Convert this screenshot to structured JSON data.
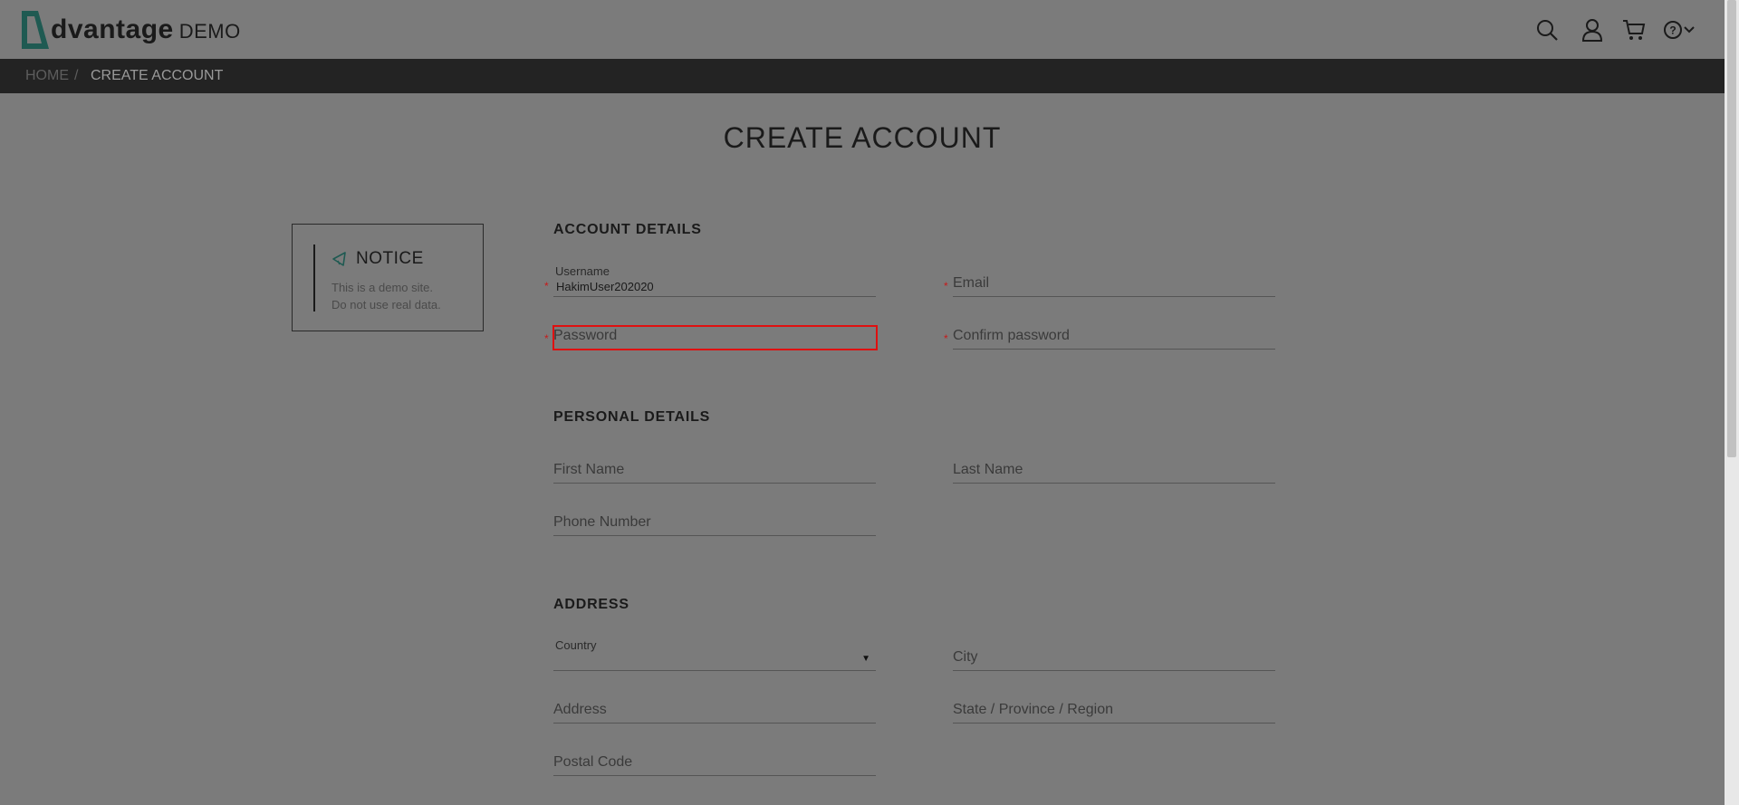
{
  "header": {
    "logo_text": "dvantage",
    "logo_demo": "DEMO",
    "icons": [
      "search-icon",
      "user-icon",
      "cart-icon",
      "help-icon",
      "chevron-down-icon"
    ]
  },
  "breadcrumb": {
    "home": "HOME",
    "separator": "/",
    "current": "CREATE ACCOUNT"
  },
  "page_title": "CREATE ACCOUNT",
  "notice": {
    "title": "NOTICE",
    "line1": "This is a demo site.",
    "line2": "Do not use real data."
  },
  "account_details": {
    "title": "ACCOUNT DETAILS",
    "username_label": "Username",
    "username_value": "HakimUser202020",
    "email_label": "Email",
    "password_label": "Password",
    "confirm_password_label": "Confirm password"
  },
  "personal_details": {
    "title": "PERSONAL DETAILS",
    "first_name_label": "First Name",
    "last_name_label": "Last Name",
    "phone_label": "Phone Number"
  },
  "address": {
    "title": "ADDRESS",
    "country_label": "Country",
    "city_label": "City",
    "address_label": "Address",
    "state_label": "State / Province / Region",
    "postal_label": "Postal Code"
  },
  "required_marker": "*",
  "dropdown_arrow": "▼",
  "colors": {
    "overlay_bg": "#7b7b7b",
    "breadcrumb_bg": "#232323",
    "required": "#c71b1b",
    "highlight": "#e01010",
    "logo_accent": "#1f5a52"
  }
}
